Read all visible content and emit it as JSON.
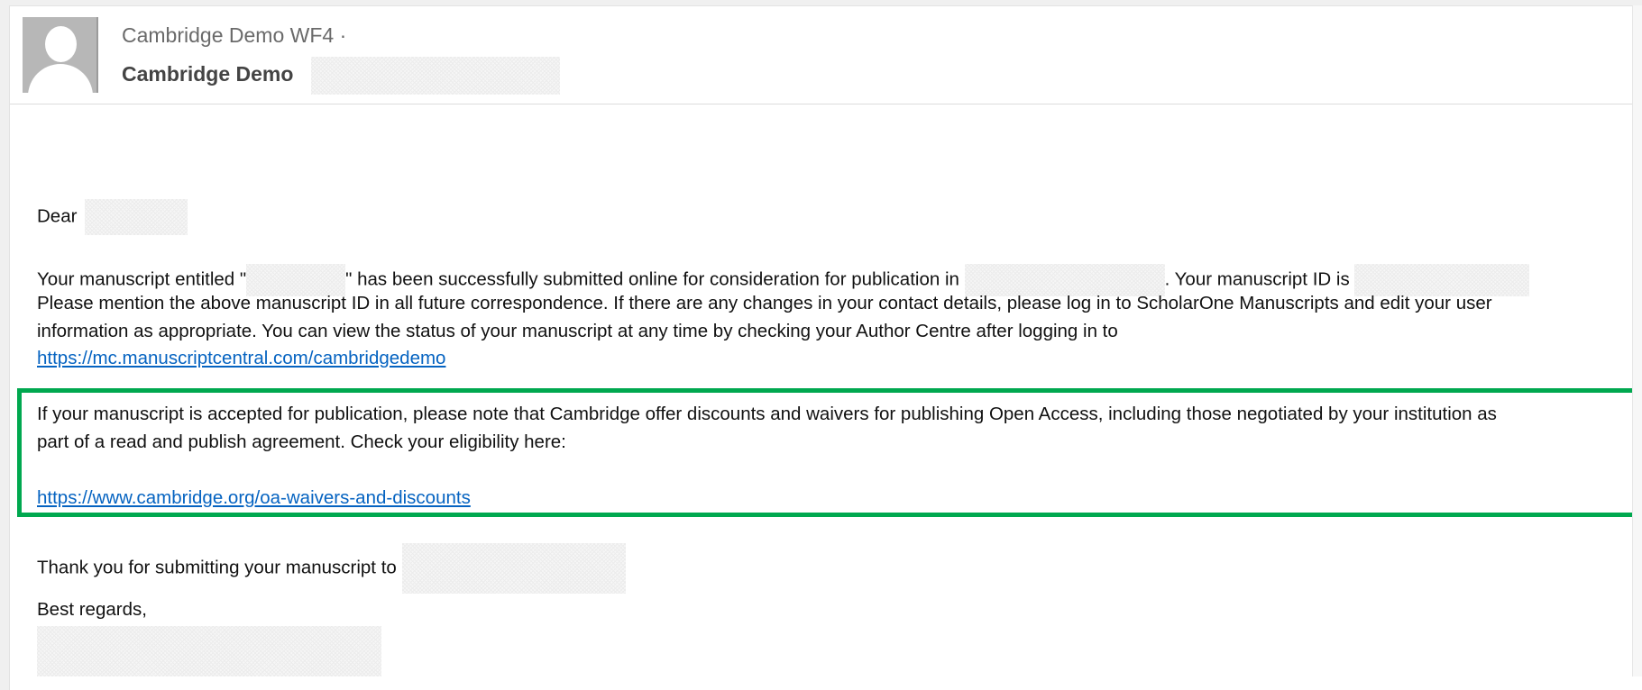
{
  "email": {
    "sender_display": "Cambridge Demo WF4 ·",
    "recipient_display": "Cambridge Demo"
  },
  "body": {
    "greeting": "Dear",
    "para1_part1": "Your manuscript entitled \"",
    "para1_part2": "\" has been successfully submitted online for consideration for publication in",
    "para1_part3": ". Your manuscript ID is",
    "para1_line2": "Please mention the above manuscript ID in all future correspondence. If there are any changes in your contact details, please log in to ScholarOne Manuscripts and edit your user",
    "para1_line3": "information as appropriate. You can view the status of your manuscript at any time by checking your Author Centre after logging in to",
    "link_manuscriptcentral": "https://mc.manuscriptcentral.com/cambridgedemo",
    "oa_line1": "If your manuscript is accepted for publication, please note that Cambridge offer discounts and waivers for publishing Open Access, including those negotiated by your institution as",
    "oa_line2": "part of a read and publish agreement. Check your eligibility here:",
    "link_oa": "https://www.cambridge.org/oa-waivers-and-discounts",
    "thanks": "Thank you for submitting your manuscript to",
    "closing": "Best regards,"
  },
  "colors": {
    "link": "#0563c1",
    "highlight_border": "#00a84f"
  }
}
